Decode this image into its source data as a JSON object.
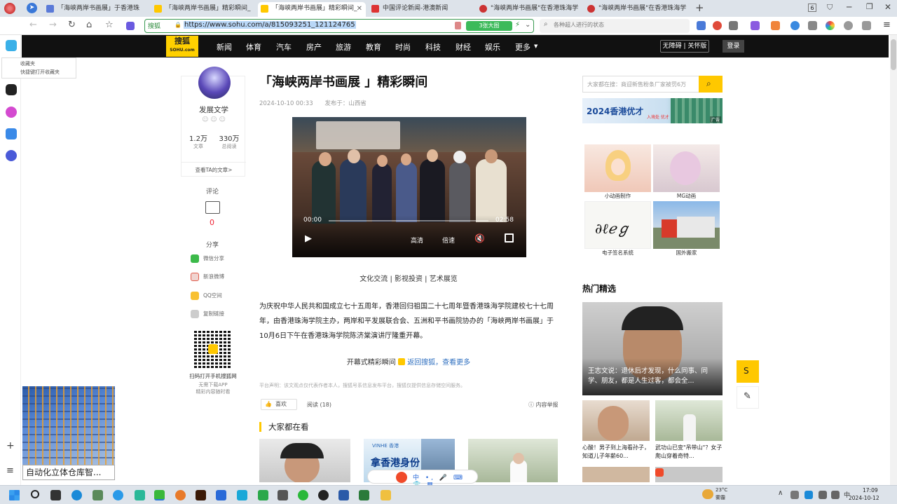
{
  "browser": {
    "tabs": [
      {
        "title": "「海峡两岸书画展」于香港珠",
        "active": false
      },
      {
        "title": "「海峡两岸书画展」精彩瞬间_",
        "active": false
      },
      {
        "title": "「海峡两岸书画展」精彩瞬间_",
        "active": true
      },
      {
        "title": "中国评论新闻-港澳新闻",
        "active": false
      },
      {
        "title": "\"海峡两岸书画展\"在香港珠海学",
        "active": false
      },
      {
        "title": "\"海峡两岸书画展\"在香港珠海学",
        "active": false
      }
    ],
    "new_tab_symbol": "+",
    "tab_count": "6",
    "url": "https://www.sohu.com/a/815093251_121124765",
    "url_badge": "搜狐",
    "url_green_button": "3张大图",
    "search_placeholder": "各种超人进行的状态"
  },
  "sidebar": {
    "favorites_popup": {
      "title": "收藏夹",
      "hint": "快捷键打开收藏夹"
    }
  },
  "sohu_nav": {
    "logo_top": "搜狐",
    "logo_bottom": "SOHU.com",
    "items": [
      "新闻",
      "体育",
      "汽车",
      "房产",
      "旅游",
      "教育",
      "时尚",
      "科技",
      "财经",
      "娱乐",
      "更多"
    ],
    "ad_free": "无障碍 | 关怀版",
    "login": "登录"
  },
  "author": {
    "name": "发展文学",
    "articles_count": "1.2万",
    "articles_label": "文章",
    "reads_count": "330万",
    "reads_label": "总阅读",
    "view_articles": "查看TA的文章>",
    "comment_label": "评论",
    "comment_count": "0",
    "share_label": "分享",
    "share_items": [
      "微信分享",
      "新浪微博",
      "QQ空间",
      "复制链接"
    ],
    "qr_caption": "扫码打开手机搜狐网",
    "qr_sub1": "无需下载APP",
    "qr_sub2": "精彩内容随时看"
  },
  "warehouse_ad": {
    "caption": "自动化立体仓库智..."
  },
  "article": {
    "title": "「海峡两岸书画展 」精彩瞬间",
    "date": "2024-10-10 00:33",
    "publisher": "发布于：山西省",
    "video": {
      "current_time": "00:00",
      "duration": "02:58",
      "quality": "高清",
      "speed": "倍速",
      "progress": 0
    },
    "tags": "文化交流 | 影视投资 | 艺术展览",
    "paragraph": "为庆祝中华人民共和国成立七十五周年，香港回归祖国二十七周年暨香港珠海学院建校七十七周年，由香港珠海学院主办，两岸和平发展联合会、五洲和平书画院协办的「海峡两岸书画展」于10月6日下午在香港珠海学院陈济棠演讲厅隆重开幕。",
    "more_text": "开幕式精彩瞬间",
    "more_link": "返回搜狐，查看更多",
    "disclaimer": "平台声明：该文观点仅代表作者本人，搜狐号系信息发布平台，搜狐仅提供信息存储空间服务。",
    "like_label": "喜欢",
    "read_label": "阅读 (18)",
    "report_label": "内容举报",
    "everyone_heading": "大家都在看",
    "thumb2_text": "拿香港身份",
    "thumb2_brand": "VINHE 香港"
  },
  "right": {
    "search_placeholder": "大家都在搜：商迎新售粉条厂家被罚6万",
    "banner_text": "2024香港优才",
    "banner_sub": "入境处 优才",
    "ad_label": "广告",
    "grid_captions": [
      "小动画制作",
      "MG动画",
      "电子签名系统",
      "国外搬家"
    ],
    "hot_heading": "热门精选",
    "hot_main_caption": "王志文说：退休后才发现，什么同事、同学、朋友，都是人生过客，都会全...",
    "hot_small": [
      "心酸！男子到上海看孙子，知道儿子年薪60...",
      "武功山已变\"吊带山\"？女子爬山穿着奇特..."
    ]
  },
  "taskbar": {
    "weather_temp": "23°C",
    "weather_desc": "雾霾",
    "time": "17:09",
    "date": "2024-10-12"
  }
}
